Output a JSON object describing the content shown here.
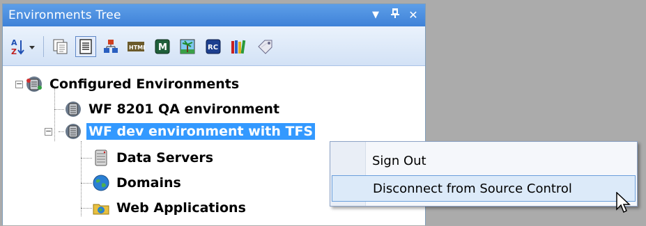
{
  "window": {
    "title": "Environments Tree",
    "buttons": {
      "dropdown": "▼",
      "pin": "📌",
      "close": "✕"
    }
  },
  "toolbar": {
    "items": [
      {
        "name": "sort-icon"
      },
      {
        "name": "copy-icon"
      },
      {
        "name": "document-icon",
        "active": true
      },
      {
        "name": "hierarchy-icon"
      },
      {
        "name": "html-icon"
      },
      {
        "name": "m-icon"
      },
      {
        "name": "image-icon"
      },
      {
        "name": "rc-icon"
      },
      {
        "name": "library-icon"
      },
      {
        "name": "tag-icon"
      }
    ]
  },
  "tree": {
    "root": "Configured Environments",
    "env1": "WF 8201 QA environment",
    "env2": "WF dev environment with TFS",
    "child1": "Data Servers",
    "child2": "Domains",
    "child3": "Web Applications"
  },
  "context_menu": {
    "items": [
      "Sign Out",
      "Disconnect from Source Control"
    ]
  },
  "colors": {
    "title_bar": "#4a8fe0",
    "selection": "#3399ff",
    "background": "#ababab"
  }
}
